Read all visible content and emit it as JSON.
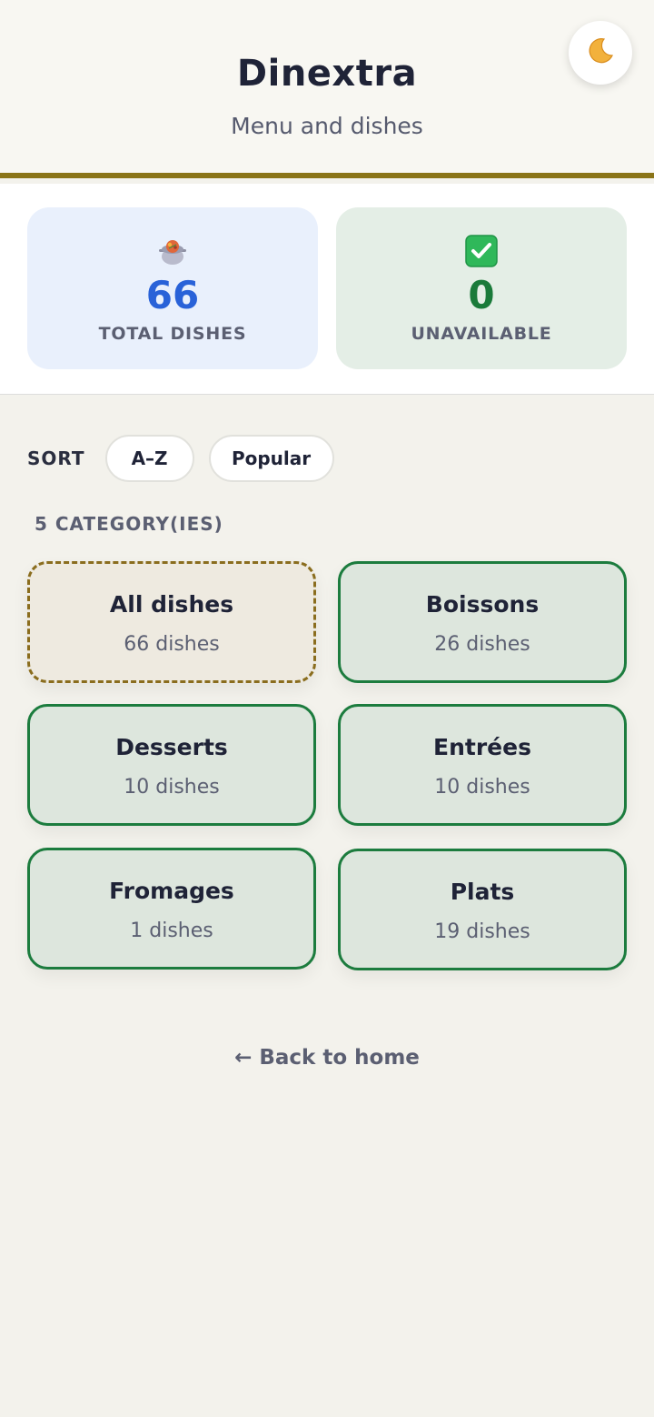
{
  "header": {
    "title": "Dinextra",
    "subtitle": "Menu and dishes",
    "theme_toggle_icon": "crescent-moon-icon"
  },
  "stats": {
    "total": {
      "icon": "pot-of-food-icon",
      "value": "66",
      "label": "TOTAL DISHES",
      "color": "#2962d8"
    },
    "unavailable": {
      "icon": "check-box-icon",
      "value": "0",
      "label": "UNAVAILABLE",
      "color": "#1a7a3a"
    }
  },
  "sort": {
    "label": "SORT",
    "options": [
      "A–Z",
      "Popular"
    ]
  },
  "categories": {
    "count_label": "5 CATEGORY(IES)",
    "items": [
      {
        "name": "All dishes",
        "count": "66 dishes"
      },
      {
        "name": "Boissons",
        "count": "26 dishes"
      },
      {
        "name": "Desserts",
        "count": "10 dishes"
      },
      {
        "name": "Entrées",
        "count": "10 dishes"
      },
      {
        "name": "Fromages",
        "count": "1 dishes"
      },
      {
        "name": "Plats",
        "count": "19 dishes"
      }
    ]
  },
  "footer": {
    "back_label": "← Back to home"
  },
  "colors": {
    "accent_bar": "#8a7418",
    "category_border": "#1c7c3e",
    "all_dishes_border": "#8a6d1e"
  }
}
